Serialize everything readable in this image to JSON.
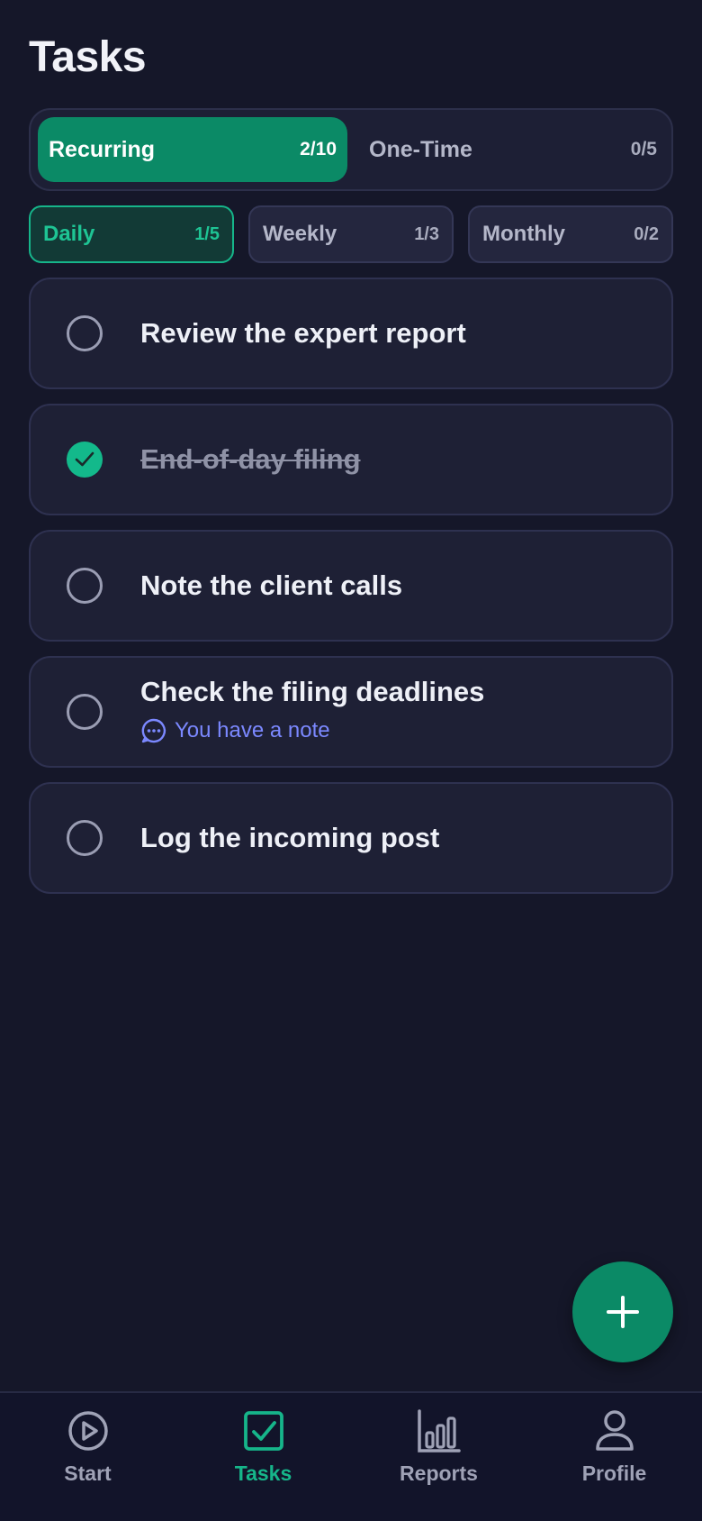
{
  "header": {
    "title": "Tasks"
  },
  "segments": [
    {
      "label": "Recurring",
      "count": "2/10",
      "active": true
    },
    {
      "label": "One-Time",
      "count": "0/5",
      "active": false
    }
  ],
  "frequencies": [
    {
      "label": "Daily",
      "count": "1/5",
      "active": true
    },
    {
      "label": "Weekly",
      "count": "1/3",
      "active": false
    },
    {
      "label": "Monthly",
      "count": "0/2",
      "active": false
    }
  ],
  "tasks": [
    {
      "label": "Review the expert report",
      "done": false
    },
    {
      "label": "End-of-day filing",
      "done": true
    },
    {
      "label": "Note the client calls",
      "done": false
    },
    {
      "label": "Check the filing deadlines",
      "done": false,
      "note": "You have a note"
    },
    {
      "label": "Log the incoming post",
      "done": false
    }
  ],
  "fab": {
    "icon": "plus-icon"
  },
  "nav": [
    {
      "label": "Start",
      "icon": "play-circle-icon",
      "active": false
    },
    {
      "label": "Tasks",
      "icon": "checkbox-icon",
      "active": true
    },
    {
      "label": "Reports",
      "icon": "bar-chart-icon",
      "active": false
    },
    {
      "label": "Profile",
      "icon": "person-icon",
      "active": false
    }
  ],
  "colors": {
    "background": "#151729",
    "accent": "#0b8a66",
    "accent_text": "#16b58a",
    "note": "#7b88ff"
  }
}
